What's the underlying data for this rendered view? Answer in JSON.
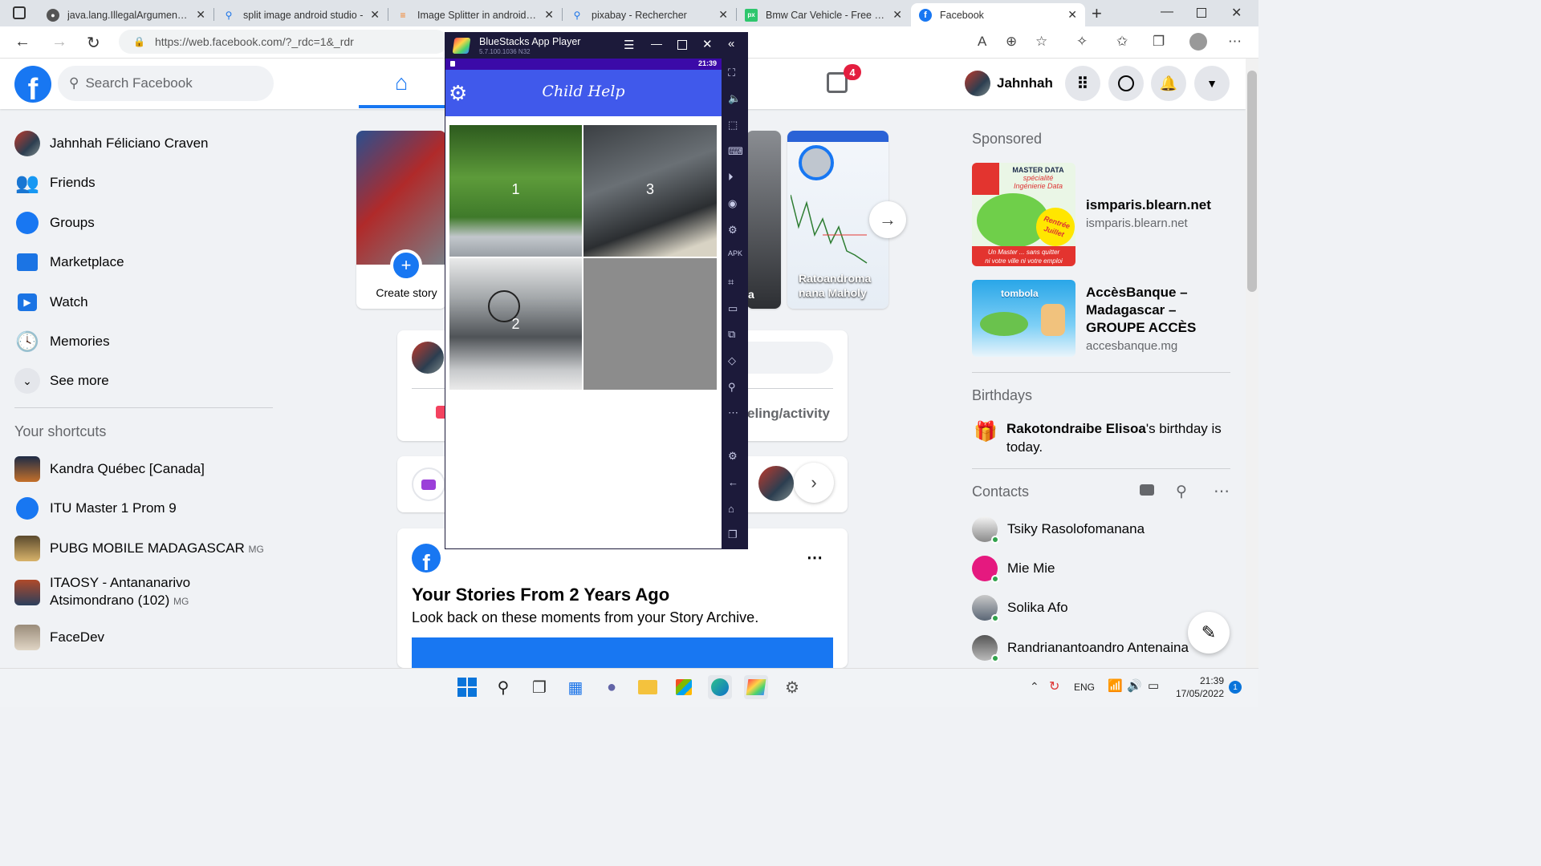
{
  "browser": {
    "tabs": [
      {
        "title": "java.lang.IllegalArgumentEx",
        "icon": "github-icon"
      },
      {
        "title": "split image android studio -",
        "icon": "search-icon"
      },
      {
        "title": "Image Splitter in android - S",
        "icon": "stackoverflow-icon"
      },
      {
        "title": "pixabay - Rechercher",
        "icon": "search-icon"
      },
      {
        "title": "Bmw Car Vehicle - Free pho",
        "icon": "pixabay-icon"
      },
      {
        "title": "Facebook",
        "icon": "facebook-icon"
      }
    ],
    "url": "https://web.facebook.com/?_rdc=1&_rdr"
  },
  "facebook": {
    "search_placeholder": "Search Facebook",
    "notifications_badge": "4",
    "profile_name": "Jahnhah",
    "left_nav": [
      {
        "label": "Jahnhah Féliciano Craven",
        "icon": "avatar"
      },
      {
        "label": "Friends",
        "icon": "friends-icon"
      },
      {
        "label": "Groups",
        "icon": "groups-icon"
      },
      {
        "label": "Marketplace",
        "icon": "marketplace-icon"
      },
      {
        "label": "Watch",
        "icon": "watch-icon"
      },
      {
        "label": "Memories",
        "icon": "memories-icon"
      },
      {
        "label": "See more",
        "icon": "chevron-down-icon"
      }
    ],
    "shortcuts_heading": "Your shortcuts",
    "shortcuts": [
      {
        "label": "Kandra Québec [Canada]",
        "suffix": ""
      },
      {
        "label": "ITU Master 1 Prom 9",
        "suffix": ""
      },
      {
        "label": "PUBG MOBILE MADAGASCAR",
        "suffix": "MG"
      },
      {
        "label": "ITAOSY - Antananarivo",
        "label2": "Atsimondrano (102)",
        "suffix": "MG"
      },
      {
        "label": "FaceDev",
        "suffix": ""
      }
    ],
    "stories": {
      "create_label": "Create story",
      "story_name": "Ratoandroma nana Maholy",
      "partial_label": "a"
    },
    "post_box": {
      "partial_action": "eling/activity"
    },
    "memories_card": {
      "title": "Your Stories From 2 Years Ago",
      "subtitle": "Look back on these moments from your Story Archive."
    },
    "sponsored_heading": "Sponsored",
    "ads": [
      {
        "title": "ismparis.blearn.net",
        "domain": "ismparis.blearn.net",
        "image_text": [
          "MASTER DATA",
          "spécialité",
          "Ingénierie Data",
          "Rentrée",
          "Juillet",
          "Un Master ... sans quitter",
          "ni votre ville ni votre emploi"
        ]
      },
      {
        "title": "AccèsBanque – Madagascar – GROUPE ACCÈS",
        "domain": "accesbanque.mg",
        "image_text": [
          "tombola"
        ]
      }
    ],
    "birthdays_heading": "Birthdays",
    "birthday_name": "Rakotondraibe Elisoa",
    "birthday_text": "'s birthday is today.",
    "contacts_heading": "Contacts",
    "contacts": [
      {
        "name": "Tsiky Rasolofomanana"
      },
      {
        "name": "Mie Mie"
      },
      {
        "name": "Solika Afo"
      },
      {
        "name": "Randrianantoandro Antenaina"
      }
    ]
  },
  "bluestacks": {
    "window_title": "BlueStacks App Player",
    "version": "5.7.100.1036  N32",
    "status_time": "21:39",
    "app_title": "Child Help",
    "tiles": [
      "1",
      "3",
      "2",
      ""
    ]
  },
  "taskbar": {
    "language": "ENG",
    "time": "21:39",
    "date": "17/05/2022",
    "notification_count": "1"
  },
  "colors": {
    "facebook_blue": "#1877f2",
    "bluestacks_frame": "#1c1a3a",
    "app_bar": "#4059eb",
    "status_bar": "#3b0aa8"
  }
}
